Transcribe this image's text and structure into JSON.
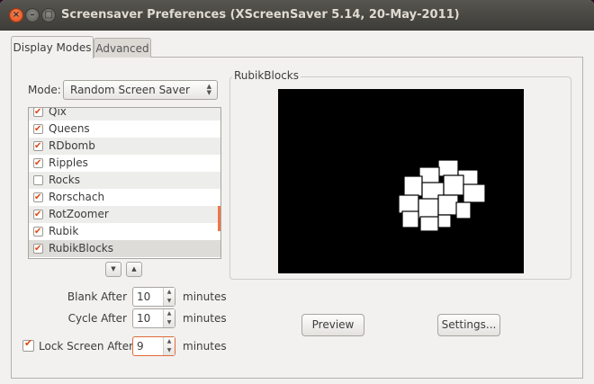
{
  "window": {
    "title": "Screensaver Preferences  (XScreenSaver 5.14, 20-May-2011)"
  },
  "tabs": [
    {
      "label": "Display Modes"
    },
    {
      "label": "Advanced"
    }
  ],
  "mode": {
    "label": "Mode:",
    "value": "Random Screen Saver"
  },
  "savers": [
    {
      "label": "Qix",
      "checked": true
    },
    {
      "label": "Queens",
      "checked": true
    },
    {
      "label": "RDbomb",
      "checked": true
    },
    {
      "label": "Ripples",
      "checked": true
    },
    {
      "label": "Rocks",
      "checked": false
    },
    {
      "label": "Rorschach",
      "checked": true
    },
    {
      "label": "RotZoomer",
      "checked": true
    },
    {
      "label": "Rubik",
      "checked": true
    },
    {
      "label": "RubikBlocks",
      "checked": true,
      "selected": true
    }
  ],
  "blank": {
    "label": "Blank After",
    "value": "10",
    "units": "minutes"
  },
  "cycle": {
    "label": "Cycle After",
    "value": "10",
    "units": "minutes"
  },
  "lock": {
    "label": "Lock Screen After",
    "value": "9",
    "units": "minutes",
    "checked": true
  },
  "preview_panel": {
    "title": "RubikBlocks"
  },
  "buttons": {
    "preview": "Preview",
    "settings": "Settings..."
  },
  "icons": {
    "close": "close-icon",
    "minimize": "minimize-icon",
    "maximize": "maximize-icon",
    "up": "up-arrow-icon",
    "down": "down-arrow-icon"
  },
  "colors": {
    "accent": "#dd4814",
    "titlebar": "#3d3c38",
    "window_bg": "#f2f1f0"
  }
}
